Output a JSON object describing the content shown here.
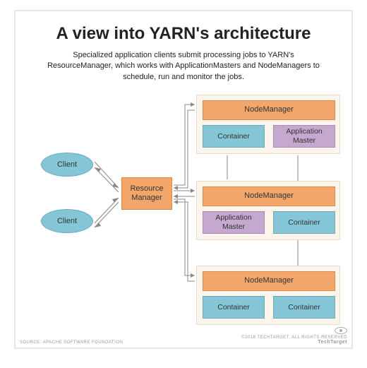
{
  "title": "A view into YARN's architecture",
  "subtitle": "Specialized application clients submit processing jobs to YARN's ResourceManager, which works with ApplicationMasters and NodeManagers to schedule, run and monitor the jobs.",
  "clients": [
    "Client",
    "Client"
  ],
  "resource_manager": "Resource Manager",
  "node_groups": [
    {
      "nodemanager": "NodeManager",
      "left": {
        "label": "Container",
        "kind": "blue"
      },
      "right": {
        "label": "Application Master",
        "kind": "purple"
      }
    },
    {
      "nodemanager": "NodeManager",
      "left": {
        "label": "Application Master",
        "kind": "purple"
      },
      "right": {
        "label": "Container",
        "kind": "blue"
      }
    },
    {
      "nodemanager": "NodeManager",
      "left": {
        "label": "Container",
        "kind": "blue"
      },
      "right": {
        "label": "Container",
        "kind": "blue"
      }
    }
  ],
  "footer": {
    "source": "SOURCE: APACHE SOFTWARE FOUNDATION",
    "rights": "©2018 TECHTARGET. ALL RIGHTS RESERVED",
    "brand": "TechTarget"
  }
}
